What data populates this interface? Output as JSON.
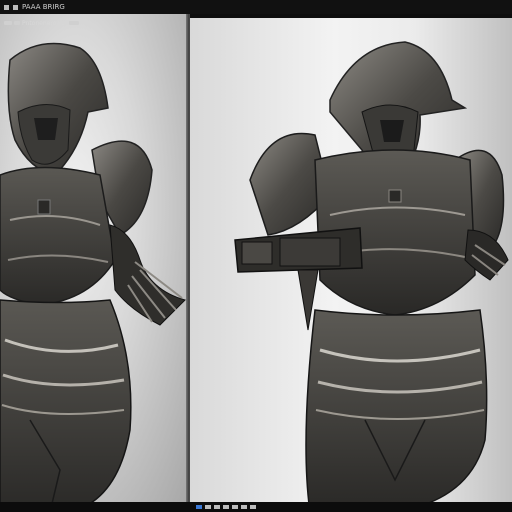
{
  "window": {
    "title": "PAAA  BRIRG"
  },
  "toolbar": {
    "label": "Pntoneneroalz-"
  },
  "viewports": {
    "left_panel": {
      "name": "viewport-left"
    },
    "right_panel": {
      "name": "viewport-right"
    }
  },
  "statusbar": {
    "indicators": [
      "tool-a",
      "tool-b",
      "tool-c",
      "tool-d",
      "tool-e",
      "tool-f",
      "tool-g"
    ]
  },
  "colors": {
    "armor_dark": "#3c3a37",
    "armor_mid": "#6a6762",
    "armor_light": "#bdbab3",
    "background_light": "#f2f2f2",
    "background_shadow": "#a5a5a5",
    "accent": "#3b79d6"
  }
}
